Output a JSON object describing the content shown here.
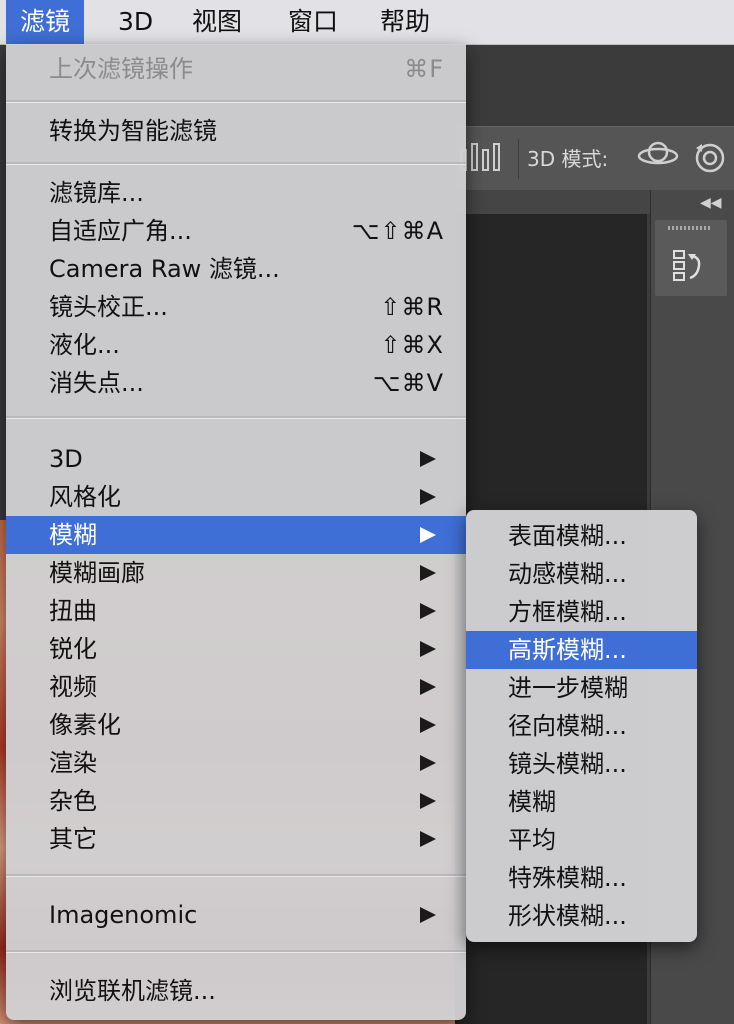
{
  "menubar": {
    "items": [
      {
        "label": "滤镜",
        "active": true
      },
      {
        "label": "3D"
      },
      {
        "label": "视图"
      },
      {
        "label": "窗口"
      },
      {
        "label": "帮助"
      }
    ]
  },
  "background": {
    "toolbar_label": "3D 模式:",
    "icons": [
      "distribute-icon",
      "orbit-3d-icon",
      "rotate-3d-icon",
      "collapse-panels-icon",
      "history-panel-icon"
    ]
  },
  "filter_menu": {
    "items": [
      {
        "label": "上次滤镜操作",
        "shortcut": "⌘F",
        "disabled": true
      },
      {
        "label": "转换为智能滤镜"
      },
      {
        "label": "滤镜库..."
      },
      {
        "label": "自适应广角...",
        "shortcut": "⌥⇧⌘A"
      },
      {
        "label": "Camera Raw 滤镜..."
      },
      {
        "label": "镜头校正...",
        "shortcut": "⇧⌘R"
      },
      {
        "label": "液化...",
        "shortcut": "⇧⌘X"
      },
      {
        "label": "消失点...",
        "shortcut": "⌥⌘V"
      },
      {
        "label": "3D",
        "submenu": true
      },
      {
        "label": "风格化",
        "submenu": true
      },
      {
        "label": "模糊",
        "submenu": true,
        "highlighted": true
      },
      {
        "label": "模糊画廊",
        "submenu": true
      },
      {
        "label": "扭曲",
        "submenu": true
      },
      {
        "label": "锐化",
        "submenu": true
      },
      {
        "label": "视频",
        "submenu": true
      },
      {
        "label": "像素化",
        "submenu": true
      },
      {
        "label": "渲染",
        "submenu": true
      },
      {
        "label": "杂色",
        "submenu": true
      },
      {
        "label": "其它",
        "submenu": true
      },
      {
        "label": "Imagenomic",
        "submenu": true
      },
      {
        "label": "浏览联机滤镜..."
      }
    ]
  },
  "blur_submenu": {
    "items": [
      {
        "label": "表面模糊..."
      },
      {
        "label": "动感模糊..."
      },
      {
        "label": "方框模糊..."
      },
      {
        "label": "高斯模糊...",
        "highlighted": true
      },
      {
        "label": "进一步模糊"
      },
      {
        "label": "径向模糊..."
      },
      {
        "label": "镜头模糊..."
      },
      {
        "label": "模糊"
      },
      {
        "label": "平均"
      },
      {
        "label": "特殊模糊..."
      },
      {
        "label": "形状模糊..."
      }
    ]
  },
  "colors": {
    "highlight": "#3f6fd6",
    "menu_bg": "#d0d0d2",
    "disabled_text": "#8b8b8d"
  }
}
